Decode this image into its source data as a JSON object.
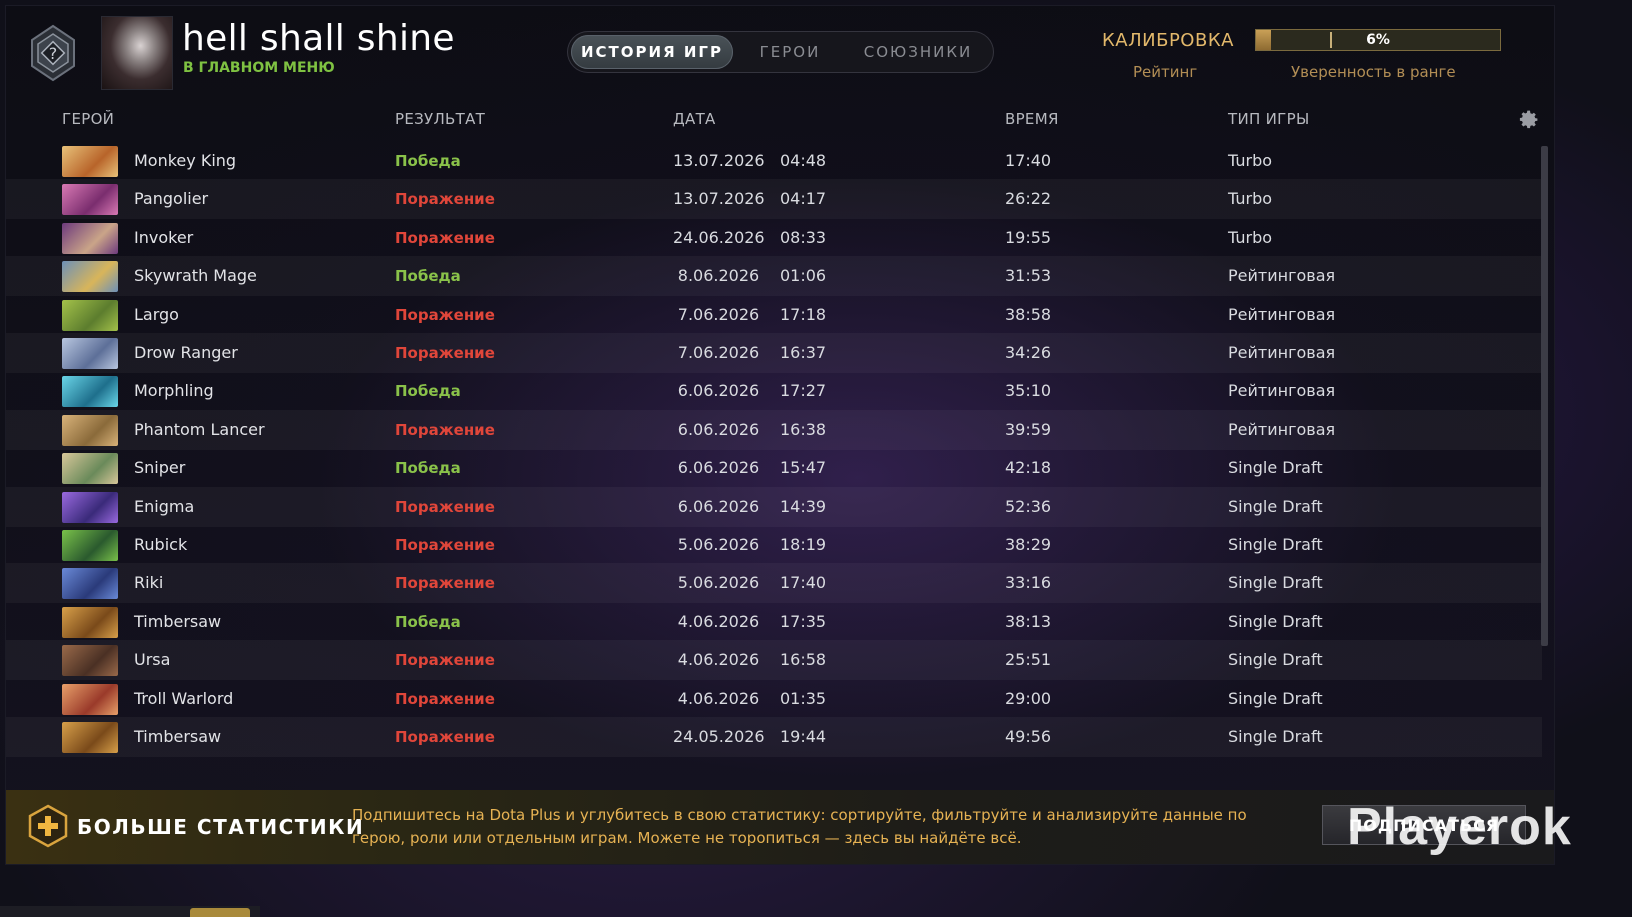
{
  "header": {
    "player_name": "hell shall shine",
    "status": "В ГЛАВНОМ МЕНЮ",
    "rank_badge_text": "?"
  },
  "tabs": [
    {
      "label": "ИСТОРИЯ ИГР",
      "active": true
    },
    {
      "label": "ГЕРОИ",
      "active": false
    },
    {
      "label": "СОЮЗНИКИ",
      "active": false
    }
  ],
  "calibration": {
    "title": "КАЛИБРОВКА",
    "rating_label": "Рейтинг",
    "confidence_label": "Уверенность в ранге",
    "percent_text": "6%",
    "percent_value": 6
  },
  "columns": {
    "hero": "ГЕРОЙ",
    "result": "РЕЗУЛЬТАТ",
    "date": "ДАТА",
    "duration": "ВРЕМЯ",
    "game_type": "ТИП ИГРЫ"
  },
  "matches": [
    {
      "hero": "Monkey King",
      "result": "Победа",
      "win": true,
      "date": "13.07.2026",
      "time": "04:48",
      "duration": "17:40",
      "type": "Turbo",
      "c1": "#b8642a",
      "c2": "#e8c27a"
    },
    {
      "hero": "Pangolier",
      "result": "Поражение",
      "win": false,
      "date": "13.07.2026",
      "time": "04:17",
      "duration": "26:22",
      "type": "Turbo",
      "c1": "#7a2d6e",
      "c2": "#d97ab4"
    },
    {
      "hero": "Invoker",
      "result": "Поражение",
      "win": false,
      "date": "24.06.2026",
      "time": "08:33",
      "duration": "19:55",
      "type": "Turbo",
      "c1": "#caa488",
      "c2": "#6d3a7d"
    },
    {
      "hero": "Skywrath Mage",
      "result": "Победа",
      "win": true,
      "date": "8.06.2026",
      "time": "01:06",
      "duration": "31:53",
      "type": "Рейтинговая",
      "c1": "#d8b55a",
      "c2": "#6d90b8"
    },
    {
      "hero": "Largo",
      "result": "Поражение",
      "win": false,
      "date": "7.06.2026",
      "time": "17:18",
      "duration": "38:58",
      "type": "Рейтинговая",
      "c1": "#5c7d2e",
      "c2": "#a4c24a"
    },
    {
      "hero": "Drow Ranger",
      "result": "Поражение",
      "win": false,
      "date": "7.06.2026",
      "time": "16:37",
      "duration": "34:26",
      "type": "Рейтинговая",
      "c1": "#5d6f98",
      "c2": "#b9c7e0"
    },
    {
      "hero": "Morphling",
      "result": "Победа",
      "win": true,
      "date": "6.06.2026",
      "time": "17:27",
      "duration": "35:10",
      "type": "Рейтинговая",
      "c1": "#1e6f8c",
      "c2": "#6ad6e8"
    },
    {
      "hero": "Phantom Lancer",
      "result": "Поражение",
      "win": false,
      "date": "6.06.2026",
      "time": "16:38",
      "duration": "39:59",
      "type": "Рейтинговая",
      "c1": "#8a6a3a",
      "c2": "#d9b37a"
    },
    {
      "hero": "Sniper",
      "result": "Победа",
      "win": true,
      "date": "6.06.2026",
      "time": "15:47",
      "duration": "42:18",
      "type": "Single Draft",
      "c1": "#6a8a5a",
      "c2": "#d8c79a"
    },
    {
      "hero": "Enigma",
      "result": "Поражение",
      "win": false,
      "date": "6.06.2026",
      "time": "14:39",
      "duration": "52:36",
      "type": "Single Draft",
      "c1": "#3a2a7a",
      "c2": "#9a6ae0"
    },
    {
      "hero": "Rubick",
      "result": "Поражение",
      "win": false,
      "date": "5.06.2026",
      "time": "18:19",
      "duration": "38:29",
      "type": "Single Draft",
      "c1": "#2a5a2e",
      "c2": "#7ac24a"
    },
    {
      "hero": "Riki",
      "result": "Поражение",
      "win": false,
      "date": "5.06.2026",
      "time": "17:40",
      "duration": "33:16",
      "type": "Single Draft",
      "c1": "#2a3a7a",
      "c2": "#6a8ad8"
    },
    {
      "hero": "Timbersaw",
      "result": "Победа",
      "win": true,
      "date": "4.06.2026",
      "time": "17:35",
      "duration": "38:13",
      "type": "Single Draft",
      "c1": "#7a4a1a",
      "c2": "#d8a04a"
    },
    {
      "hero": "Ursa",
      "result": "Поражение",
      "win": false,
      "date": "4.06.2026",
      "time": "16:58",
      "duration": "25:51",
      "type": "Single Draft",
      "c1": "#4a3024",
      "c2": "#9a6a4a"
    },
    {
      "hero": "Troll Warlord",
      "result": "Поражение",
      "win": false,
      "date": "4.06.2026",
      "time": "01:35",
      "duration": "29:00",
      "type": "Single Draft",
      "c1": "#9a3a2a",
      "c2": "#e8a06a"
    },
    {
      "hero": "Timbersaw",
      "result": "Поражение",
      "win": false,
      "date": "24.05.2026",
      "time": "19:44",
      "duration": "49:56",
      "type": "Single Draft",
      "c1": "#7a4a1a",
      "c2": "#d8a04a"
    }
  ],
  "banner": {
    "title": "БОЛЬШЕ СТАТИСТИКИ",
    "text": "Подпишитесь на Dota Plus и углубитесь в свою статистику: сортируйте, фильтруйте и анализируйте данные по герою, роли или отдельным играм. Можете не торопиться — здесь вы найдёте всё.",
    "button": "ПОДПИСАТЬСЯ"
  },
  "watermark": "Playerok",
  "colors": {
    "win": "#8ac24a",
    "loss": "#e0463a",
    "status": "#7fc242",
    "gold": "#e2b86b"
  }
}
